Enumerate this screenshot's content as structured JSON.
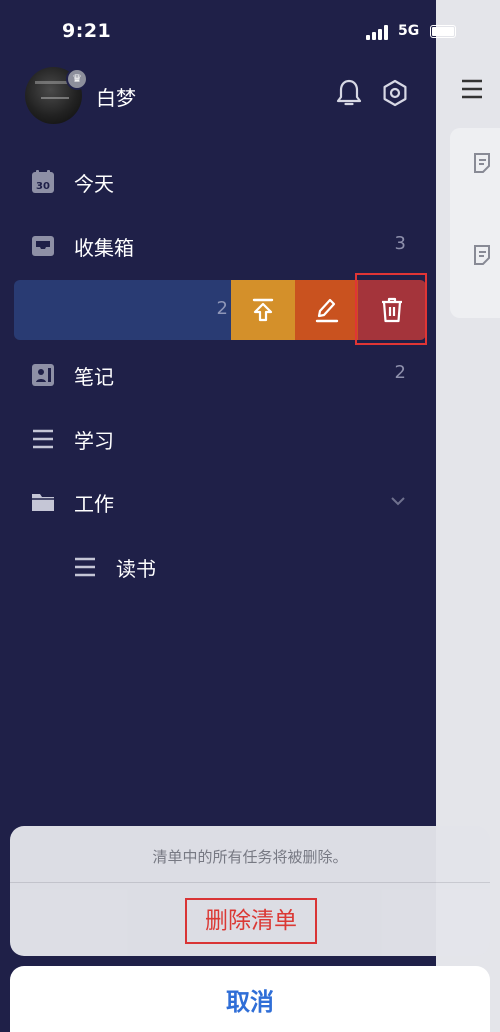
{
  "status_bar": {
    "time": "9:21",
    "network": "5G",
    "battery_fill": 1.0
  },
  "header": {
    "username": "白梦",
    "notification_icon": "bell-icon",
    "settings_icon": "settings-icon"
  },
  "main_menu_icon": "hamburger-menu-icon",
  "lists": [
    {
      "label": "今天",
      "icon": "calendar-icon",
      "icon_text": "30",
      "count": ""
    },
    {
      "label": "收集箱",
      "icon": "inbox-icon",
      "count": "3"
    },
    {
      "label": "笔记",
      "icon": "notebook-icon",
      "count": "2"
    },
    {
      "label": "学习",
      "icon": "list-icon",
      "count": ""
    },
    {
      "label": "工作",
      "icon": "folder-icon",
      "count": "",
      "expandable": true
    },
    {
      "label": "读书",
      "icon": "list-icon",
      "count": "",
      "indent": true
    }
  ],
  "swiped_row": {
    "count": "2",
    "actions": [
      {
        "name": "pin-to-top",
        "icon": "pin-top-icon",
        "color": "#d4902a"
      },
      {
        "name": "edit",
        "icon": "edit-icon",
        "color": "#c9521f"
      },
      {
        "name": "delete",
        "icon": "trash-icon",
        "color": "#a4343b"
      }
    ]
  },
  "action_sheet": {
    "message": "清单中的所有任务将被删除。",
    "delete_label": "删除清单",
    "cancel_label": "取消"
  },
  "colors": {
    "drawer_bg": "#1f2048",
    "destructive": "#e23a35",
    "cancel_blue": "#2f6ed7"
  }
}
